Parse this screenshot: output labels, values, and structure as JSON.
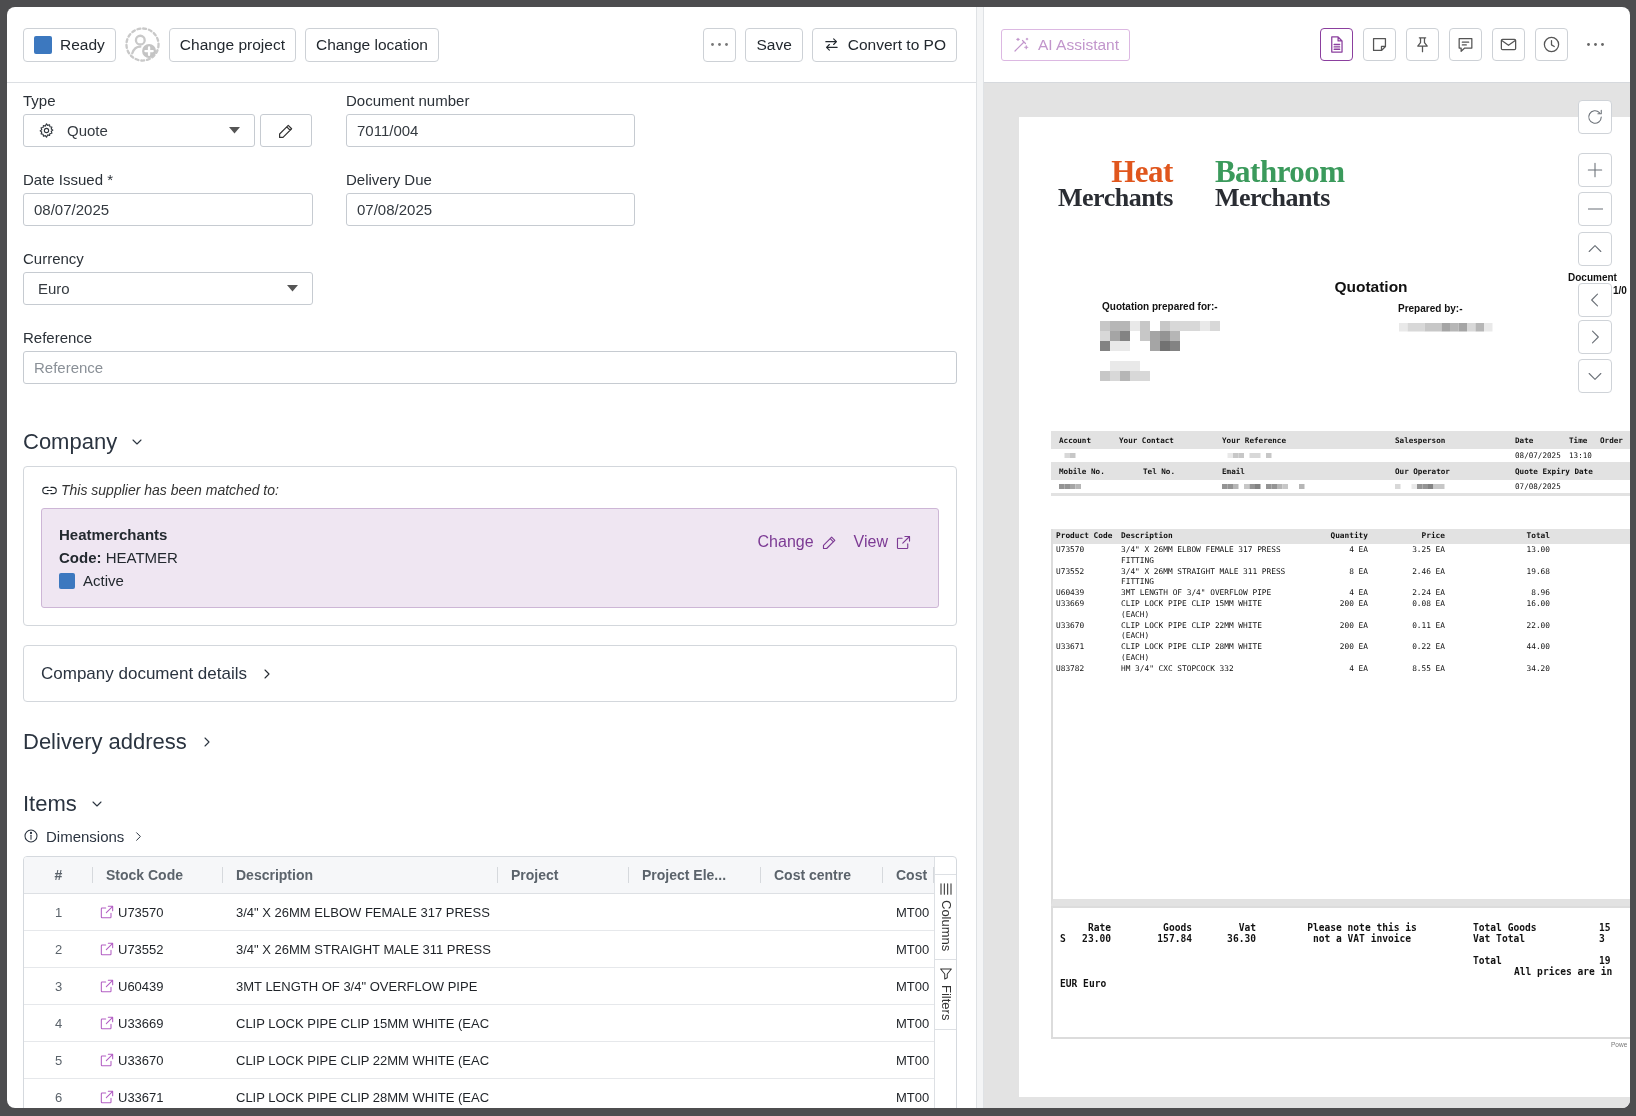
{
  "left_toolbar": {
    "status": {
      "label": "Ready",
      "color": "#3c78bf"
    },
    "buttons": [
      {
        "kind": "assign"
      },
      {
        "kind": "text",
        "label": "Change project"
      },
      {
        "kind": "text",
        "label": "Change location"
      }
    ],
    "actions": [
      {
        "kind": "more"
      },
      {
        "kind": "text",
        "label": "Save"
      },
      {
        "kind": "convert",
        "label": "Convert to PO"
      }
    ]
  },
  "form": {
    "type": {
      "label": "Type",
      "value": "Quote"
    },
    "document_number": {
      "label": "Document number",
      "value": "7011/004"
    },
    "date_issued": {
      "label": "Date Issued *",
      "value": "08/07/2025"
    },
    "delivery_due": {
      "label": "Delivery Due",
      "value": "07/08/2025"
    },
    "currency": {
      "label": "Currency",
      "value": "Euro"
    },
    "reference": {
      "label": "Reference",
      "placeholder": "Reference"
    }
  },
  "company": {
    "title": "Company",
    "expanded": true,
    "match_note": "This supplier has been matched to:",
    "supplier": {
      "name": "Heatmerchants",
      "code": "**Code:** HEATMER",
      "status": {
        "label": "Active",
        "color": "#3c78bf"
      }
    },
    "links": [
      {
        "kind": "edit",
        "label": "Change"
      },
      {
        "kind": "open",
        "label": "View"
      }
    ]
  },
  "company_document_details": {
    "title": "Company document details",
    "expanded": false
  },
  "delivery_address": {
    "title": "Delivery address",
    "expanded": false
  },
  "items": {
    "title": "Items",
    "expanded": true,
    "dimensions": {
      "label": "Dimensions",
      "expanded": false
    },
    "table": {
      "columns": [
        "#",
        "Stock Code",
        "Description",
        "Project",
        "Project Ele...",
        "Cost centre",
        "Cost"
      ],
      "rows": [
        {
          "number": "1",
          "stock_code": "U73570",
          "description": "3/4\" X 26MM ELBOW FEMALE 317 PRESS",
          "cost": "MT00"
        },
        {
          "number": "2",
          "stock_code": "U73552",
          "description": "3/4\" X 26MM STRAIGHT MALE 311 PRESS",
          "cost": "MT00"
        },
        {
          "number": "3",
          "stock_code": "U60439",
          "description": "3MT LENGTH OF 3/4\" OVERFLOW PIPE",
          "cost": "MT00"
        },
        {
          "number": "4",
          "stock_code": "U33669",
          "description": "CLIP LOCK PIPE CLIP 15MM WHITE (EAC",
          "cost": "MT00"
        },
        {
          "number": "5",
          "stock_code": "U33670",
          "description": "CLIP LOCK PIPE CLIP 22MM WHITE (EAC",
          "cost": "MT00"
        },
        {
          "number": "6",
          "stock_code": "U33671",
          "description": "CLIP LOCK PIPE CLIP 28MM WHITE (EAC",
          "cost": "MT00"
        }
      ],
      "side_tabs": [
        {
          "kind": "columns",
          "label": "Columns"
        },
        {
          "kind": "filters",
          "label": "Filters"
        }
      ]
    }
  },
  "preview": {
    "ai_button": "AI Assistant",
    "tool_tabs": [
      {
        "kind": "document",
        "selected": true
      },
      {
        "kind": "note",
        "selected": false
      },
      {
        "kind": "pin",
        "selected": false
      },
      {
        "kind": "comment",
        "selected": false
      },
      {
        "kind": "mail",
        "selected": false
      },
      {
        "kind": "history",
        "selected": false
      }
    ],
    "document": {
      "logos": [
        {
          "top": "Heat",
          "bottom": "Merchants",
          "color": "#e0561d"
        },
        {
          "top": "Bathroom",
          "bottom": "Merchants",
          "color": "#3b9a5c"
        }
      ],
      "title": "Quotation",
      "doc_label": "Document",
      "doc_number": "1/0",
      "prepared_for": "Quotation prepared for:-",
      "prepared_by": "Prepared by:-",
      "info_rows": [
        {
          "kind": "header",
          "cells": [
            "Account",
            "Your Contact",
            "Your Reference",
            "Salesperson",
            "Date",
            "Time",
            "Order"
          ]
        },
        {
          "kind": "values",
          "cells": [
            "08/07/2025",
            "13:10"
          ]
        },
        {
          "kind": "header",
          "cells": [
            "Mobile No.",
            "Tel No.",
            "Email",
            "Our Operator",
            "Quote Expiry Date"
          ]
        },
        {
          "kind": "values",
          "cells": [
            "07/08/2025"
          ]
        }
      ],
      "products": {
        "columns": [
          "Product Code",
          "Description",
          "Quantity",
          "Price",
          "Total"
        ],
        "rows": [
          {
            "code": "U73570",
            "description": "3/4\" X 26MM ELBOW FEMALE 317 PRESS FITTING",
            "quantity": "4 EA",
            "price": "3.25 EA",
            "total": "13.00"
          },
          {
            "code": "U73552",
            "description": "3/4\" X 26MM STRAIGHT MALE 311 PRESS FITTING",
            "quantity": "8 EA",
            "price": "2.46 EA",
            "total": "19.68"
          },
          {
            "code": "U60439",
            "description": "3MT LENGTH OF 3/4\" OVERFLOW PIPE",
            "quantity": "4 EA",
            "price": "2.24 EA",
            "total": "8.96"
          },
          {
            "code": "U33669",
            "description": "CLIP LOCK PIPE CLIP 15MM WHITE (EACH)",
            "quantity": "200 EA",
            "price": "0.08 EA",
            "total": "16.00"
          },
          {
            "code": "U33670",
            "description": "CLIP LOCK PIPE CLIP 22MM WHITE (EACH)",
            "quantity": "200 EA",
            "price": "0.11 EA",
            "total": "22.00"
          },
          {
            "code": "U33671",
            "description": "CLIP LOCK PIPE CLIP 28MM WHITE (EACH)",
            "quantity": "200 EA",
            "price": "0.22 EA",
            "total": "44.00"
          },
          {
            "code": "U83782",
            "description": "HM 3/4\" CXC STOPCOCK 332",
            "quantity": "4 EA",
            "price": "8.55 EA",
            "total": "34.20"
          }
        ]
      },
      "footer": {
        "vat_columns": [
          "Rate",
          "Goods",
          "Vat"
        ],
        "vat_row": [
          "S",
          "23.00",
          "157.84",
          "36.30"
        ],
        "note": "Please note this is not a VAT invoice",
        "totals": [
          {
            "label": "Total Goods",
            "value": "15"
          },
          {
            "label": "Vat Total",
            "value": "3"
          },
          {
            "label": "Total",
            "value": "19"
          }
        ],
        "prices_note": "All prices are in",
        "currency": "EUR Euro"
      },
      "powered": "Powe"
    }
  }
}
